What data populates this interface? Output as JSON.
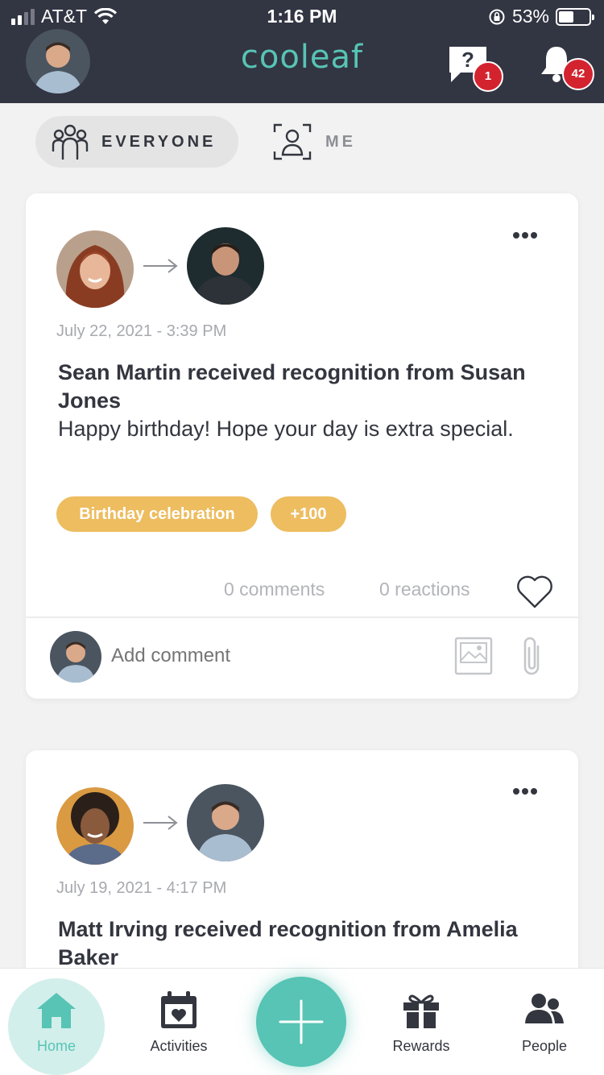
{
  "status_bar": {
    "carrier": "AT&T",
    "time": "1:16 PM",
    "battery": "53%"
  },
  "header": {
    "logo": "cooleaf",
    "help_badge": "1",
    "notification_badge": "42"
  },
  "filters": {
    "everyone_label": "EVERYONE",
    "me_label": "ME",
    "selected": "EVERYONE"
  },
  "colors": {
    "header_bg": "#323542",
    "accent": "#57c4b5",
    "tag": "#edbd60",
    "badge": "#d3232f"
  },
  "feed": [
    {
      "date": "July 22, 2021 - 3:39 PM",
      "headline": "Sean Martin received recognition from Susan Jones",
      "message": "Happy birthday! Hope your day is extra special.",
      "tags": [
        "Birthday celebration",
        "+100"
      ],
      "comments": "0 comments",
      "reactions": "0 reactions",
      "comment_placeholder": "Add comment"
    },
    {
      "date": "July 19, 2021 - 4:17 PM",
      "headline": "Matt Irving received recognition from Amelia Baker"
    }
  ],
  "bottom_nav": {
    "home": "Home",
    "activities": "Activities",
    "rewards": "Rewards",
    "people": "People"
  },
  "icons": [
    "help-icon",
    "bell-icon",
    "group-icon",
    "person-focus-icon",
    "more-icon",
    "arrow-right-icon",
    "heart-icon",
    "image-icon",
    "paperclip-icon",
    "home-icon",
    "calendar-icon",
    "plus-icon",
    "gift-icon",
    "people-icon"
  ]
}
